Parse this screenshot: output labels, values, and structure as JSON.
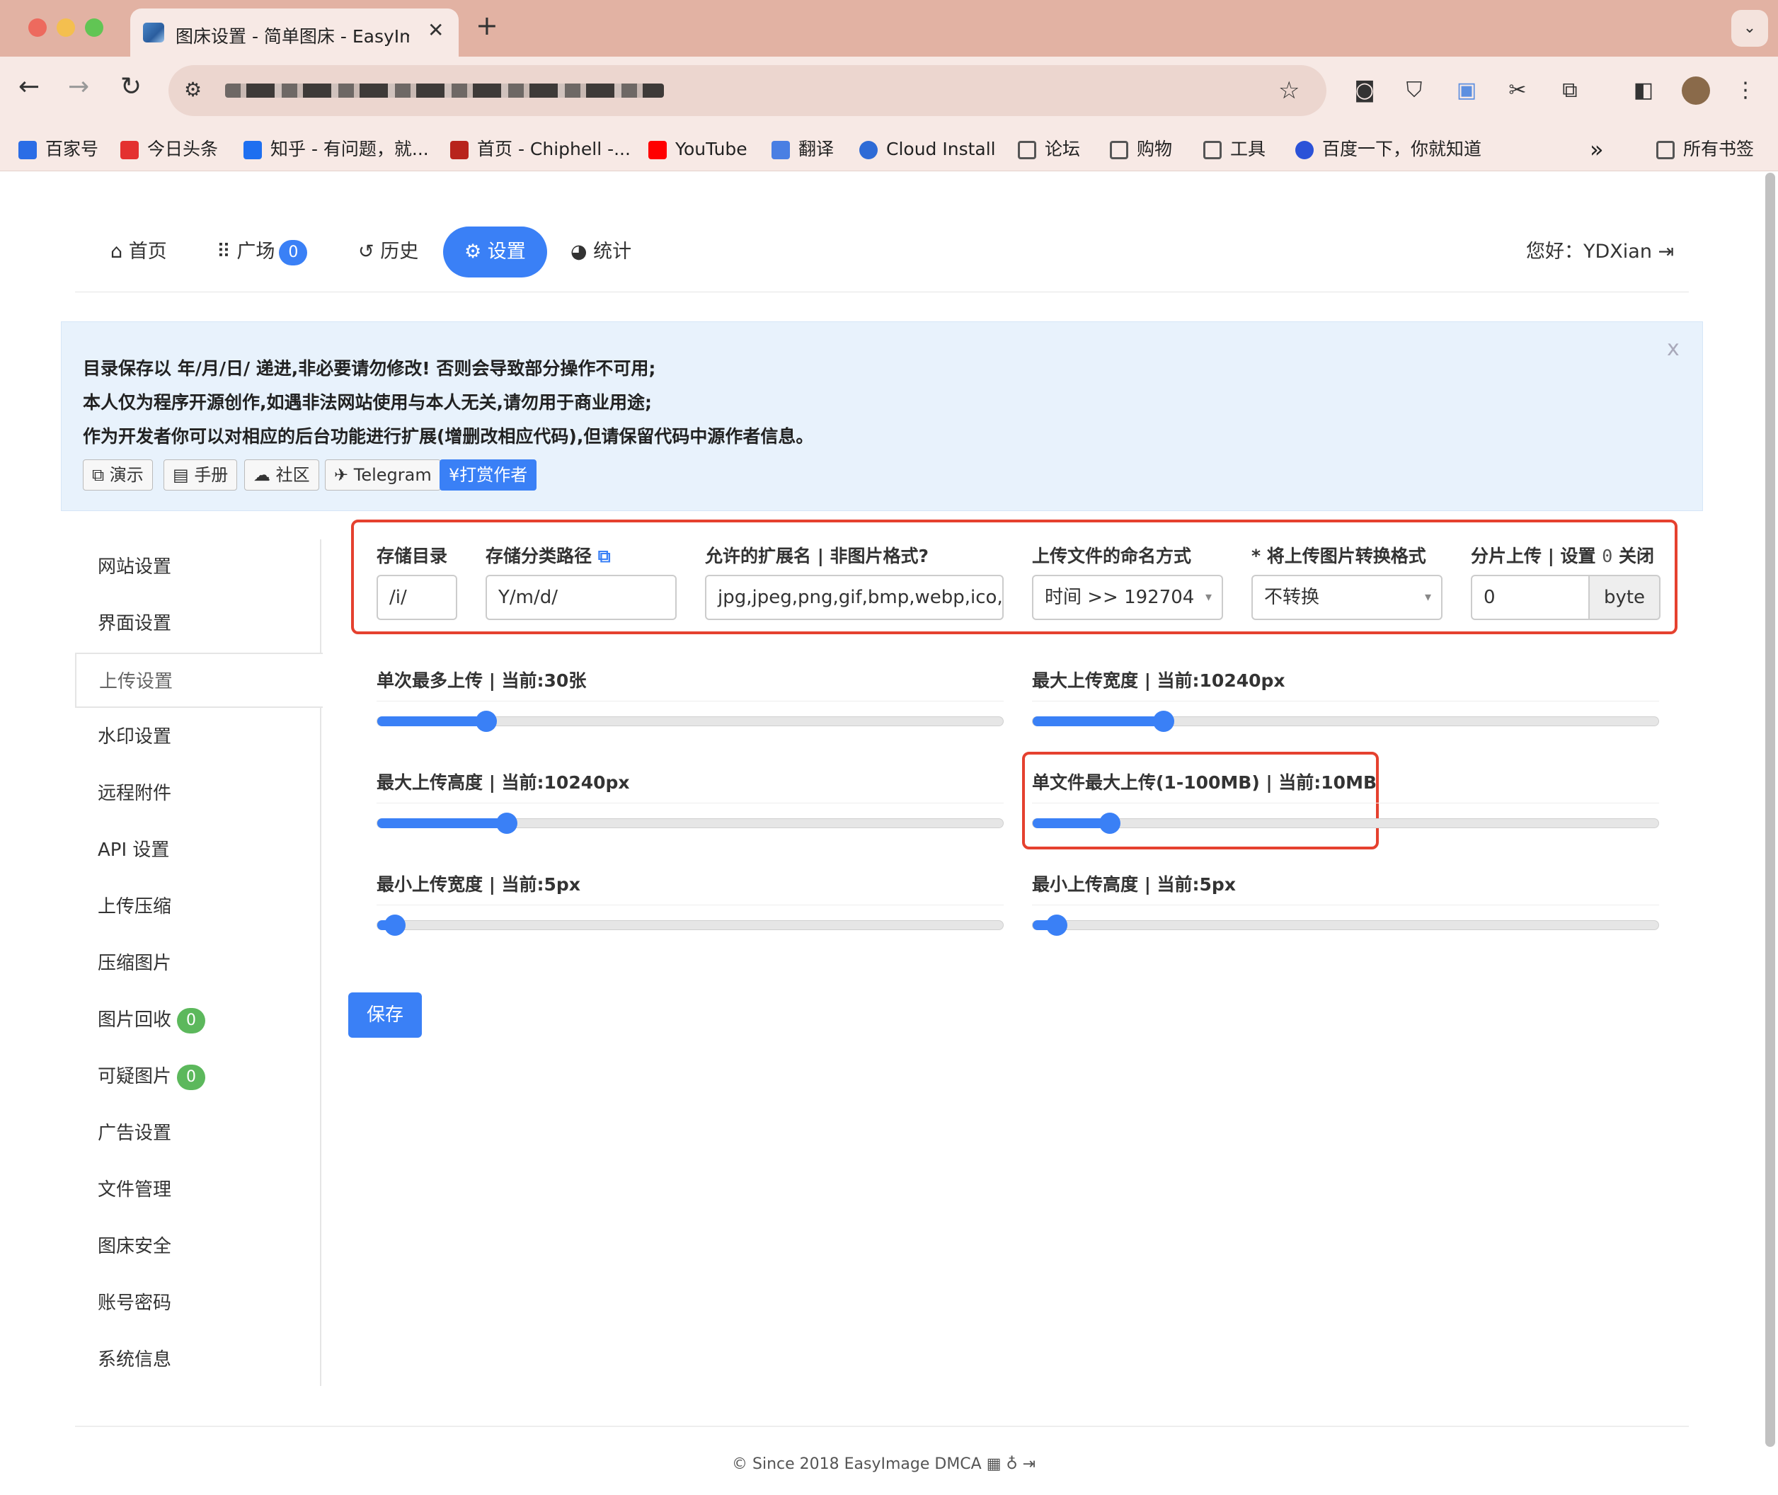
{
  "browser": {
    "tab_title": "图床设置 - 简单图床 - EasyImage",
    "tab_close": "✕",
    "new_tab": "+",
    "tab_dropdown": "⌄",
    "bookmarks": [
      {
        "label": "百家号",
        "color": "#2b6de6"
      },
      {
        "label": "今日头条",
        "color": "#e43130"
      },
      {
        "label": "知乎 - 有问题，就...",
        "color": "#1e6ff0"
      },
      {
        "label": "首页 - Chiphell -...",
        "color": "#b8241c"
      },
      {
        "label": "YouTube",
        "color": "#ff0000"
      },
      {
        "label": "翻译",
        "color": "#4a7fe3"
      },
      {
        "label": "Cloud Install",
        "color": "#2e6bd6"
      },
      {
        "label": "论坛",
        "color": "folder"
      },
      {
        "label": "购物",
        "color": "folder"
      },
      {
        "label": "工具",
        "color": "folder"
      },
      {
        "label": "百度一下，你就知道",
        "color": "#2b52d8"
      }
    ],
    "more_bookmarks": "»",
    "all_bookmarks": "所有书签"
  },
  "nav": {
    "items": [
      {
        "icon": "home-icon",
        "label": "首页"
      },
      {
        "icon": "grid-icon",
        "label": "广场",
        "badge": "0"
      },
      {
        "icon": "history-icon",
        "label": "历史"
      },
      {
        "icon": "gear-icon",
        "label": "设置",
        "active": true
      },
      {
        "icon": "pie-chart-icon",
        "label": "统计"
      }
    ],
    "greeting": "您好：YDXian"
  },
  "notice": {
    "lines": [
      "目录保存以 年/月/日/ 递进,非必要请勿修改! 否则会导致部分操作不可用;",
      "本人仅为程序开源创作,如遇非法网站使用与本人无关,请勿用于商业用途;",
      "作为开发者你可以对相应的后台功能进行扩展(增删改相应代码),但请保留代码中源作者信息。"
    ],
    "close": "x",
    "buttons": [
      "演示",
      "手册",
      "社区",
      "Telegram",
      "¥打赏作者"
    ]
  },
  "sidebar": {
    "items": [
      {
        "label": "网站设置"
      },
      {
        "label": "界面设置"
      },
      {
        "label": "上传设置",
        "active": true
      },
      {
        "label": "水印设置"
      },
      {
        "label": "远程附件"
      },
      {
        "label": "API 设置"
      },
      {
        "label": "上传压缩"
      },
      {
        "label": "压缩图片"
      },
      {
        "label": "图片回收",
        "badge": "0"
      },
      {
        "label": "可疑图片",
        "badge": "0"
      },
      {
        "label": "广告设置"
      },
      {
        "label": "文件管理"
      },
      {
        "label": "图床安全"
      },
      {
        "label": "账号密码"
      },
      {
        "label": "系统信息"
      }
    ]
  },
  "form": {
    "storage_dir": {
      "label": "存储目录",
      "value": "/i/"
    },
    "storage_path": {
      "label": "存储分类路径",
      "value": "Y/m/d/"
    },
    "extensions": {
      "label": "允许的扩展名 | 非图片格式?",
      "value": "jpg,jpeg,png,gif,bmp,webp,ico,jfif"
    },
    "naming": {
      "label": "上传文件的命名方式",
      "value": "时间 >> 192704"
    },
    "convert": {
      "label": "* 将上传图片转换格式",
      "value": "不转换"
    },
    "chunk": {
      "label_pre": "分片上传 | 设置",
      "label_code": "0",
      "label_post": "关闭",
      "value": "0",
      "unit": "byte"
    },
    "sliders": [
      {
        "label": "单次最多上传 | 当前:30张",
        "fraction": 0.174
      },
      {
        "label": "最大上传宽度 | 当前:10240px",
        "fraction": 0.209
      },
      {
        "label": "最大上传高度 | 当前:10240px",
        "fraction": 0.207
      },
      {
        "label": "单文件最大上传(1-100MB) | 当前:10MB",
        "fraction": 0.123
      },
      {
        "label": "最小上传宽度 | 当前:5px",
        "fraction": 0.028
      },
      {
        "label": "最小上传高度 | 当前:5px",
        "fraction": 0.039
      }
    ],
    "save": "保存"
  },
  "footer": {
    "text": "© Since 2018 EasyImage DMCA"
  }
}
